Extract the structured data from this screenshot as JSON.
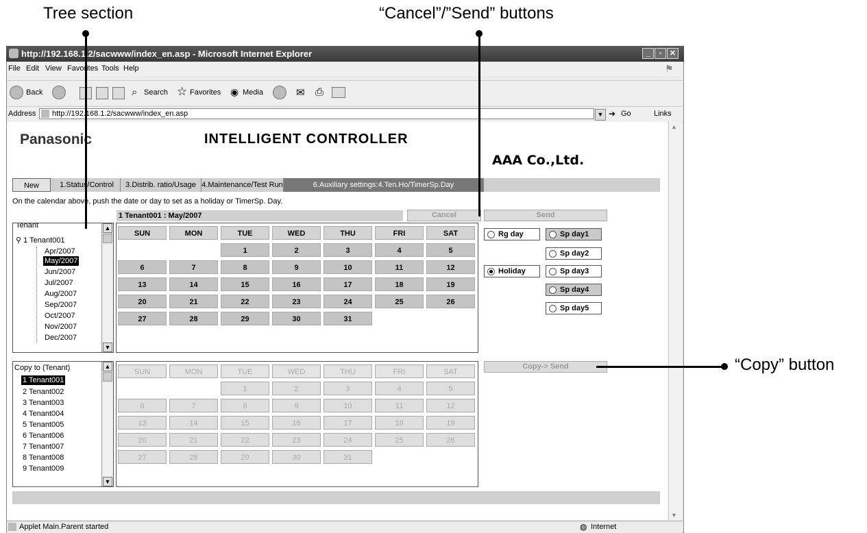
{
  "annotations": {
    "tree": "Tree section",
    "cancel_send": "“Cancel”/”Send” buttons",
    "copy": "“Copy” button"
  },
  "window": {
    "title": "http://192.168.1.2/sacwww/index_en.asp - Microsoft Internet Explorer",
    "menu": [
      "File",
      "Edit",
      "View",
      "Favorites",
      "Tools",
      "Help"
    ],
    "toolbar": {
      "back": "Back",
      "search": "Search",
      "favorites": "Favorites",
      "media": "Media"
    },
    "address_label": "Address",
    "address": "http://192.168.1.2/sacwww/index_en.asp",
    "go": "Go",
    "links": "Links",
    "status_left": "Applet Main.Parent started",
    "status_right": "Internet"
  },
  "app": {
    "logo": "Panasonic",
    "title": "INTELLIGENT CONTROLLER",
    "company": "AAA Co.,Ltd.",
    "tabs": [
      "New",
      "1.Status/Control",
      "3.Distrib. ratio/Usage",
      "4.Maintenance/Test Run",
      "6.Auxiliary settings:4.Ten.Ho/TimerSp.Day"
    ],
    "instruction": "On the calendar above, push the date or day to set as a holiday or TimerSp. Day.",
    "calendar_header": "1 Tenant001 : May/2007",
    "cancel": "Cancel",
    "send": "Send",
    "copy_send": "Copy-> Send"
  },
  "tree": {
    "title": "Tenant",
    "root": "1 Tenant001",
    "months": [
      "Apr/2007",
      "May/2007",
      "Jun/2007",
      "Jul/2007",
      "Aug/2007",
      "Sep/2007",
      "Oct/2007",
      "Nov/2007",
      "Dec/2007"
    ],
    "selected": "May/2007"
  },
  "copy_tree": {
    "title": "Copy to (Tenant)",
    "items": [
      "1 Tenant001",
      "2 Tenant002",
      "3 Tenant003",
      "4 Tenant004",
      "5 Tenant005",
      "6 Tenant006",
      "7 Tenant007",
      "8 Tenant008",
      "9 Tenant009"
    ],
    "selected": "1 Tenant001"
  },
  "calendar": {
    "days": [
      "SUN",
      "MON",
      "TUE",
      "WED",
      "THU",
      "FRI",
      "SAT"
    ],
    "rows": [
      [
        "",
        "",
        "1",
        "2",
        "3",
        "4",
        "5"
      ],
      [
        "6",
        "7",
        "8",
        "9",
        "10",
        "11",
        "12"
      ],
      [
        "13",
        "14",
        "15",
        "16",
        "17",
        "18",
        "19"
      ],
      [
        "20",
        "21",
        "22",
        "23",
        "24",
        "25",
        "26"
      ],
      [
        "27",
        "28",
        "29",
        "30",
        "31",
        "",
        ""
      ]
    ]
  },
  "options": {
    "rg_day": "Rg day",
    "holiday": "Holiday",
    "sp_days": [
      "Sp day1",
      "Sp day2",
      "Sp day3",
      "Sp day4",
      "Sp day5"
    ],
    "checked": "Holiday"
  }
}
